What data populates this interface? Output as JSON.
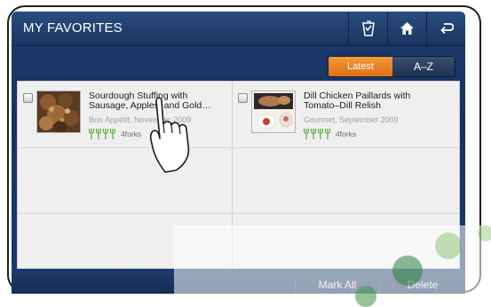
{
  "header": {
    "title": "MY FAVORITES",
    "icons": [
      "shopping-list-icon",
      "home-icon",
      "back-icon"
    ]
  },
  "sort": {
    "latest_label": "Latest",
    "az_label": "A–Z",
    "active": "Latest"
  },
  "recipes": [
    {
      "title": "Sourdough Stuffing with Sausage, Apples, and Gold…",
      "source": "Bon Appétit, November 2009",
      "rating_label": "4forks",
      "rating": 4
    },
    {
      "title": "Dill Chicken Paillards with Tomato–Dill Relish",
      "source": "Gourmet, September 2009",
      "rating_label": "4forks",
      "rating": 4
    }
  ],
  "footer": {
    "mark_all_label": "Mark All",
    "delete_label": "Delete"
  },
  "colors": {
    "accent_orange": "#e87c1f",
    "fork_green": "#5aa832",
    "header_blue": "#1c3a6a"
  }
}
